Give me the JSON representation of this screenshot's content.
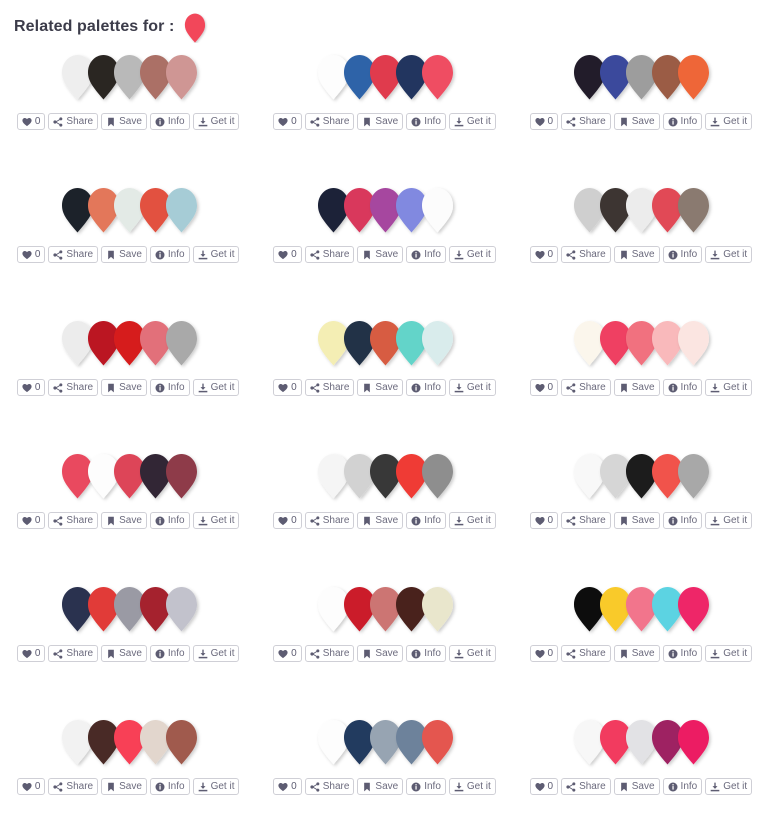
{
  "header": {
    "title": "Related palettes for :",
    "drop_icon": "drop-pin-icon",
    "drop_color": "#f2465a"
  },
  "buttons": {
    "like": {
      "label": "0",
      "icon": "heart-icon"
    },
    "share": {
      "label": "Share",
      "icon": "share-nodes-icon"
    },
    "save": {
      "label": "Save",
      "icon": "bookmark-icon"
    },
    "info": {
      "label": "Info",
      "icon": "info-circle-icon"
    },
    "get": {
      "label": "Get it",
      "icon": "download-icon"
    }
  },
  "colors": {
    "button_border": "#cfcfd6",
    "button_text": "#6b6a7d",
    "page_background": "#ffffff",
    "title_text": "#3c3c4a"
  },
  "palettes": [
    {
      "index": 1,
      "swatches": [
        "#eeeeee",
        "#2b2523",
        "#b9b9b9",
        "#ab6f66",
        "#cf9694"
      ]
    },
    {
      "index": 2,
      "swatches": [
        "#fdfdfd",
        "#2f63a8",
        "#e03a4e",
        "#21355e",
        "#ef4d62"
      ]
    },
    {
      "index": 3,
      "swatches": [
        "#221f2c",
        "#3a4a9c",
        "#9d9d9d",
        "#9b5c45",
        "#ee6638"
      ]
    },
    {
      "index": 4,
      "swatches": [
        "#1d242c",
        "#e3775a",
        "#e3eae6",
        "#e2513f",
        "#a6ccd6"
      ]
    },
    {
      "index": 5,
      "swatches": [
        "#1d2339",
        "#d9395c",
        "#a6479f",
        "#8189e0",
        "#fcfcfc"
      ]
    },
    {
      "index": 6,
      "swatches": [
        "#cfcfcf",
        "#3c3532",
        "#ececec",
        "#e14a56",
        "#8a7a6f"
      ]
    },
    {
      "index": 7,
      "swatches": [
        "#ececec",
        "#bb1423",
        "#d61f1f",
        "#e2707a",
        "#a9a9a9"
      ]
    },
    {
      "index": 8,
      "swatches": [
        "#f4eeb4",
        "#213246",
        "#d75c42",
        "#63d4c9",
        "#d9ecec"
      ]
    },
    {
      "index": 9,
      "swatches": [
        "#fbf6ec",
        "#ef4162",
        "#f1717f",
        "#f9b9bb",
        "#fbe5e1"
      ]
    },
    {
      "index": 10,
      "swatches": [
        "#e94a5e",
        "#fdfdfd",
        "#dd4559",
        "#322734",
        "#8e3a48"
      ]
    },
    {
      "index": 11,
      "swatches": [
        "#f5f5f5",
        "#d2d2d2",
        "#393939",
        "#ef3b35",
        "#8e8e8e"
      ]
    },
    {
      "index": 12,
      "swatches": [
        "#f8f8f8",
        "#d6d6d6",
        "#1c1c1c",
        "#f1534c",
        "#a8a8a8"
      ]
    },
    {
      "index": 13,
      "swatches": [
        "#2a3150",
        "#e13b38",
        "#9a9aa4",
        "#a5202d",
        "#c2c2cc"
      ]
    },
    {
      "index": 14,
      "swatches": [
        "#fdfdfd",
        "#cb1f2c",
        "#cc7573",
        "#49211c",
        "#e9e6cc"
      ]
    },
    {
      "index": 15,
      "swatches": [
        "#080808",
        "#f9ca2b",
        "#f2758c",
        "#5bd3e2",
        "#ee2667"
      ]
    },
    {
      "index": 16,
      "swatches": [
        "#f2f2f2",
        "#4a2a25",
        "#f83f56",
        "#e2d6cd",
        "#a05a4d"
      ]
    },
    {
      "index": 17,
      "swatches": [
        "#fdfdfd",
        "#243a5e",
        "#97a4b2",
        "#6d829b",
        "#e4564f"
      ]
    },
    {
      "index": 18,
      "swatches": [
        "#f7f7f7",
        "#f23a5e",
        "#e2e2e5",
        "#9e2062",
        "#ec1f63"
      ]
    }
  ]
}
